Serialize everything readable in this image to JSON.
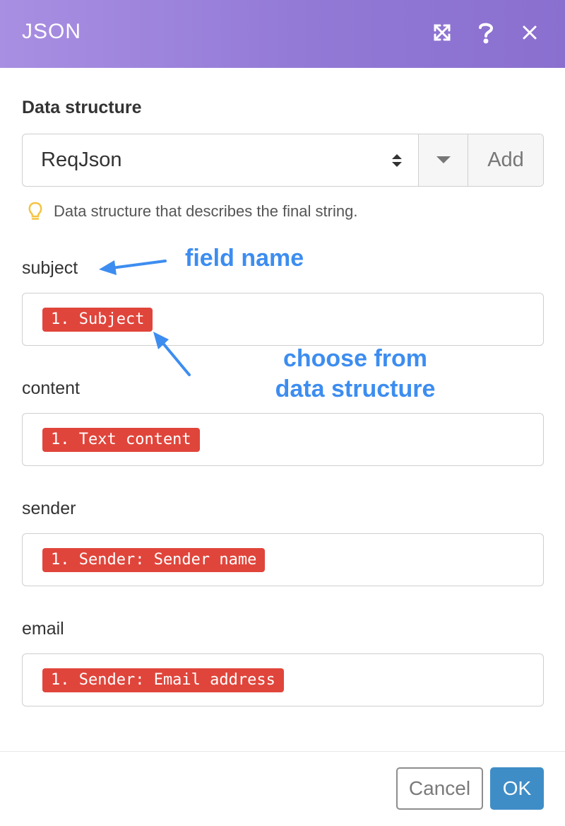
{
  "header": {
    "title": "JSON"
  },
  "icons": {
    "expand": "expand-icon",
    "help": "question-mark-icon",
    "close": "close-icon",
    "lightbulb": "lightbulb-icon"
  },
  "data_structure": {
    "label": "Data structure",
    "selected": "ReqJson",
    "add_label": "Add",
    "hint": "Data structure that describes the final string."
  },
  "fields": [
    {
      "label": "subject",
      "value": "1. Subject"
    },
    {
      "label": "content",
      "value": "1. Text content"
    },
    {
      "label": "sender",
      "value": "1. Sender: Sender name"
    },
    {
      "label": "email",
      "value": "1. Sender: Email address"
    }
  ],
  "annotations": {
    "field_name": "field name",
    "choose_line1": "choose from",
    "choose_line2": "data structure"
  },
  "footer": {
    "cancel_label": "Cancel",
    "ok_label": "OK"
  },
  "colors": {
    "header_gradient_start": "#a98fe2",
    "header_gradient_end": "#8a6fcf",
    "pill": "#e0453b",
    "annotation": "#3d8df0",
    "ok_button": "#3f8dc7",
    "hint_bulb": "#f5c342"
  }
}
